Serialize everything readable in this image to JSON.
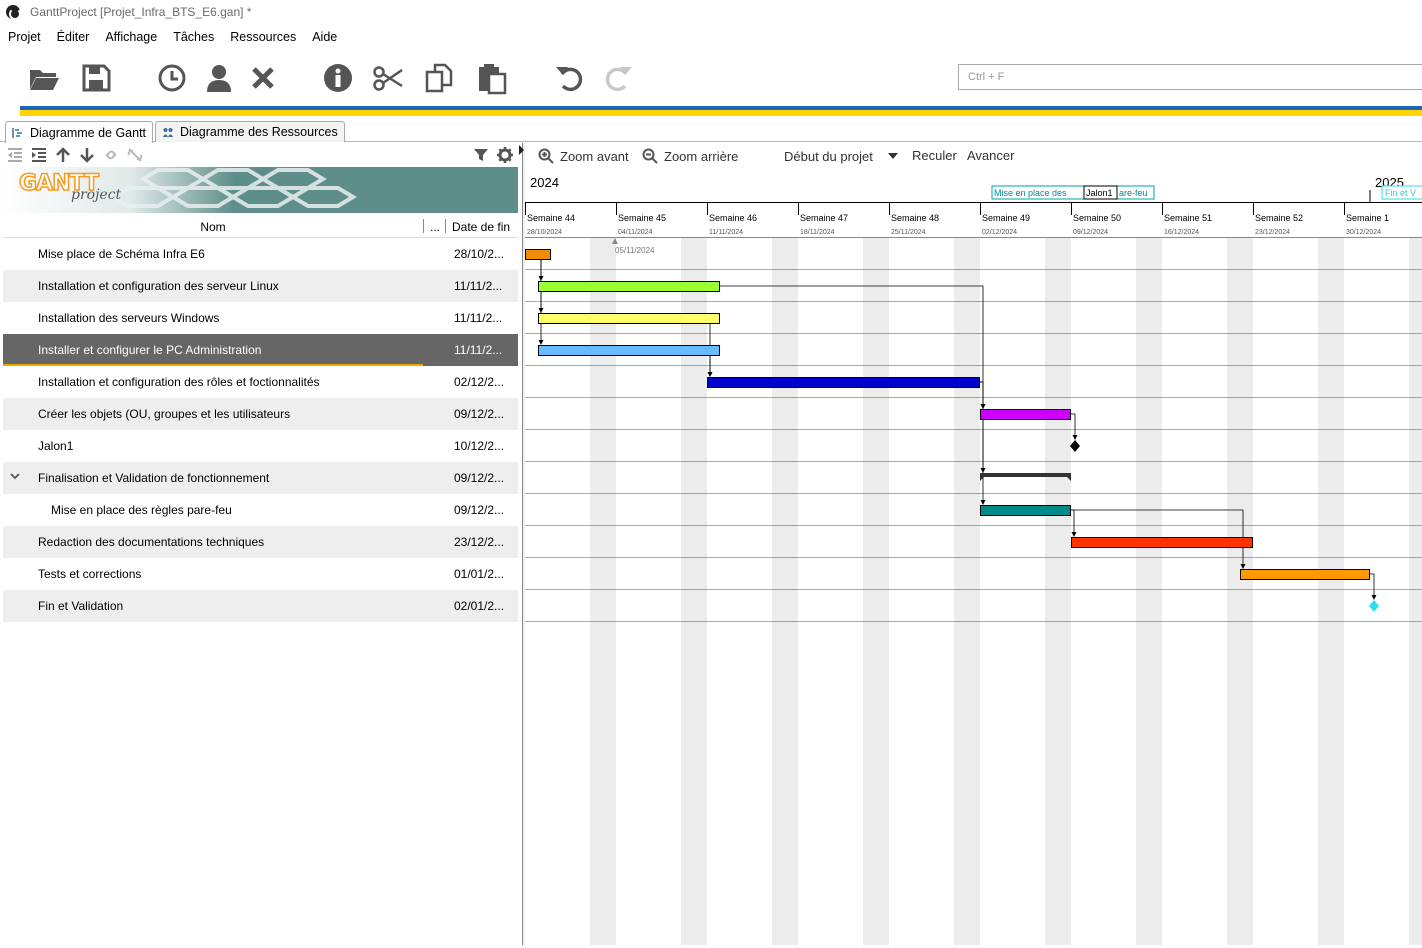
{
  "window": {
    "title": "GanttProject [Projet_Infra_BTS_E6.gan] *"
  },
  "menu": [
    "Projet",
    "Éditer",
    "Affichage",
    "Tâches",
    "Ressources",
    "Aide"
  ],
  "toolbar": {
    "icons": [
      "folder-open-icon",
      "save-icon",
      "clock-icon",
      "user-icon",
      "delete-icon",
      "info-icon",
      "cut-icon",
      "copy-icon",
      "paste-icon",
      "undo-icon",
      "redo-icon"
    ],
    "search_placeholder": "Ctrl + F"
  },
  "tabs": [
    {
      "label": "Diagramme de Gantt",
      "active": true
    },
    {
      "label": "Diagramme des Ressources",
      "active": false
    }
  ],
  "logo": {
    "word1": "GANTT",
    "word2": "project"
  },
  "table": {
    "col_name": "Nom",
    "col_more": "...",
    "col_end": "Date de fin",
    "rows": [
      {
        "name": "Mise place de Schéma Infra E6",
        "end": "28/10/2..."
      },
      {
        "name": "Installation et configuration des serveur Linux",
        "end": "11/11/2..."
      },
      {
        "name": "Installation  des serveurs Windows",
        "end": "11/11/2..."
      },
      {
        "name": "Installer et configurer le PC Administration",
        "end": "11/11/2...",
        "selected": true
      },
      {
        "name": "Installation et configuration des rôles et foctionnalités",
        "end": "02/12/2..."
      },
      {
        "name": "Créer les objets (OU, groupes et les utilisateurs",
        "end": "09/12/2..."
      },
      {
        "name": "Jalon1",
        "end": "10/12/2..."
      },
      {
        "name": "Finalisation et Validation de fonctionnement",
        "end": "09/12/2...",
        "expandable": true
      },
      {
        "name": "Mise en place des règles pare-feu",
        "end": "09/12/2...",
        "child": true
      },
      {
        "name": "Redaction des documentations techniques",
        "end": "23/12/2..."
      },
      {
        "name": "Tests et corrections",
        "end": "01/01/2..."
      },
      {
        "name": "Fin et Validation",
        "end": "02/01/2..."
      }
    ]
  },
  "chart_toolbar": {
    "zoom_in": "Zoom avant",
    "zoom_out": "Zoom arrière",
    "project_start": "Début du projet",
    "back": "Reculer",
    "forward": "Avancer"
  },
  "timeline": {
    "years": [
      "2024",
      "2025"
    ],
    "weeks": [
      {
        "label": "Semaine 44",
        "date": "28/10/2024"
      },
      {
        "label": "Semaine 45",
        "date": "04/11/2024"
      },
      {
        "label": "Semaine 46",
        "date": "11/11/2024"
      },
      {
        "label": "Semaine 47",
        "date": "18/11/2024"
      },
      {
        "label": "Semaine 48",
        "date": "25/11/2024"
      },
      {
        "label": "Semaine 49",
        "date": "02/12/2024"
      },
      {
        "label": "Semaine 50",
        "date": "09/12/2024"
      },
      {
        "label": "Semaine 51",
        "date": "16/12/2024"
      },
      {
        "label": "Semaine 52",
        "date": "23/12/2024"
      },
      {
        "label": "Semaine 1",
        "date": "30/12/2024"
      }
    ],
    "today_marker": "05/11/2024",
    "milestone_labels": {
      "left": "Mise en place des",
      "middle": "Jalon1",
      "right": "are-feu",
      "far": "Fin et V"
    }
  },
  "bars": [
    {
      "row": 0,
      "start": "28/10/2024",
      "end": "29/10/2024",
      "color": "#f08c00",
      "type": "task"
    },
    {
      "row": 1,
      "start": "29/10/2024",
      "end": "11/11/2024",
      "color": "#99ff33",
      "type": "task"
    },
    {
      "row": 2,
      "start": "29/10/2024",
      "end": "11/11/2024",
      "color": "#ffff66",
      "type": "task"
    },
    {
      "row": 3,
      "start": "29/10/2024",
      "end": "11/11/2024",
      "color": "#66bbff",
      "type": "task"
    },
    {
      "row": 4,
      "start": "11/11/2024",
      "end": "01/12/2024",
      "color": "#0000cc",
      "type": "task"
    },
    {
      "row": 5,
      "start": "02/12/2024",
      "end": "08/12/2024",
      "color": "#cc00ff",
      "type": "task"
    },
    {
      "row": 6,
      "start": "09/12/2024",
      "color": "#000000",
      "type": "milestone"
    },
    {
      "row": 7,
      "start": "02/12/2024",
      "end": "08/12/2024",
      "color": "#333333",
      "type": "summary"
    },
    {
      "row": 8,
      "start": "02/12/2024",
      "end": "08/12/2024",
      "color": "#008b8b",
      "type": "task"
    },
    {
      "row": 9,
      "start": "09/12/2024",
      "end": "22/12/2024",
      "color": "#ff3300",
      "type": "task"
    },
    {
      "row": 10,
      "start": "22/12/2024",
      "end": "31/12/2024",
      "color": "#ff9900",
      "type": "task"
    },
    {
      "row": 11,
      "start": "01/01/2025",
      "color": "#33ddee",
      "type": "milestone"
    }
  ],
  "dependencies": [
    [
      0,
      1
    ],
    [
      0,
      2
    ],
    [
      0,
      3
    ],
    [
      1,
      5
    ],
    [
      2,
      4
    ],
    [
      3,
      4
    ],
    [
      4,
      5
    ],
    [
      5,
      6
    ],
    [
      4,
      7
    ],
    [
      4,
      8
    ],
    [
      8,
      9
    ],
    [
      8,
      10
    ],
    [
      10,
      11
    ]
  ]
}
